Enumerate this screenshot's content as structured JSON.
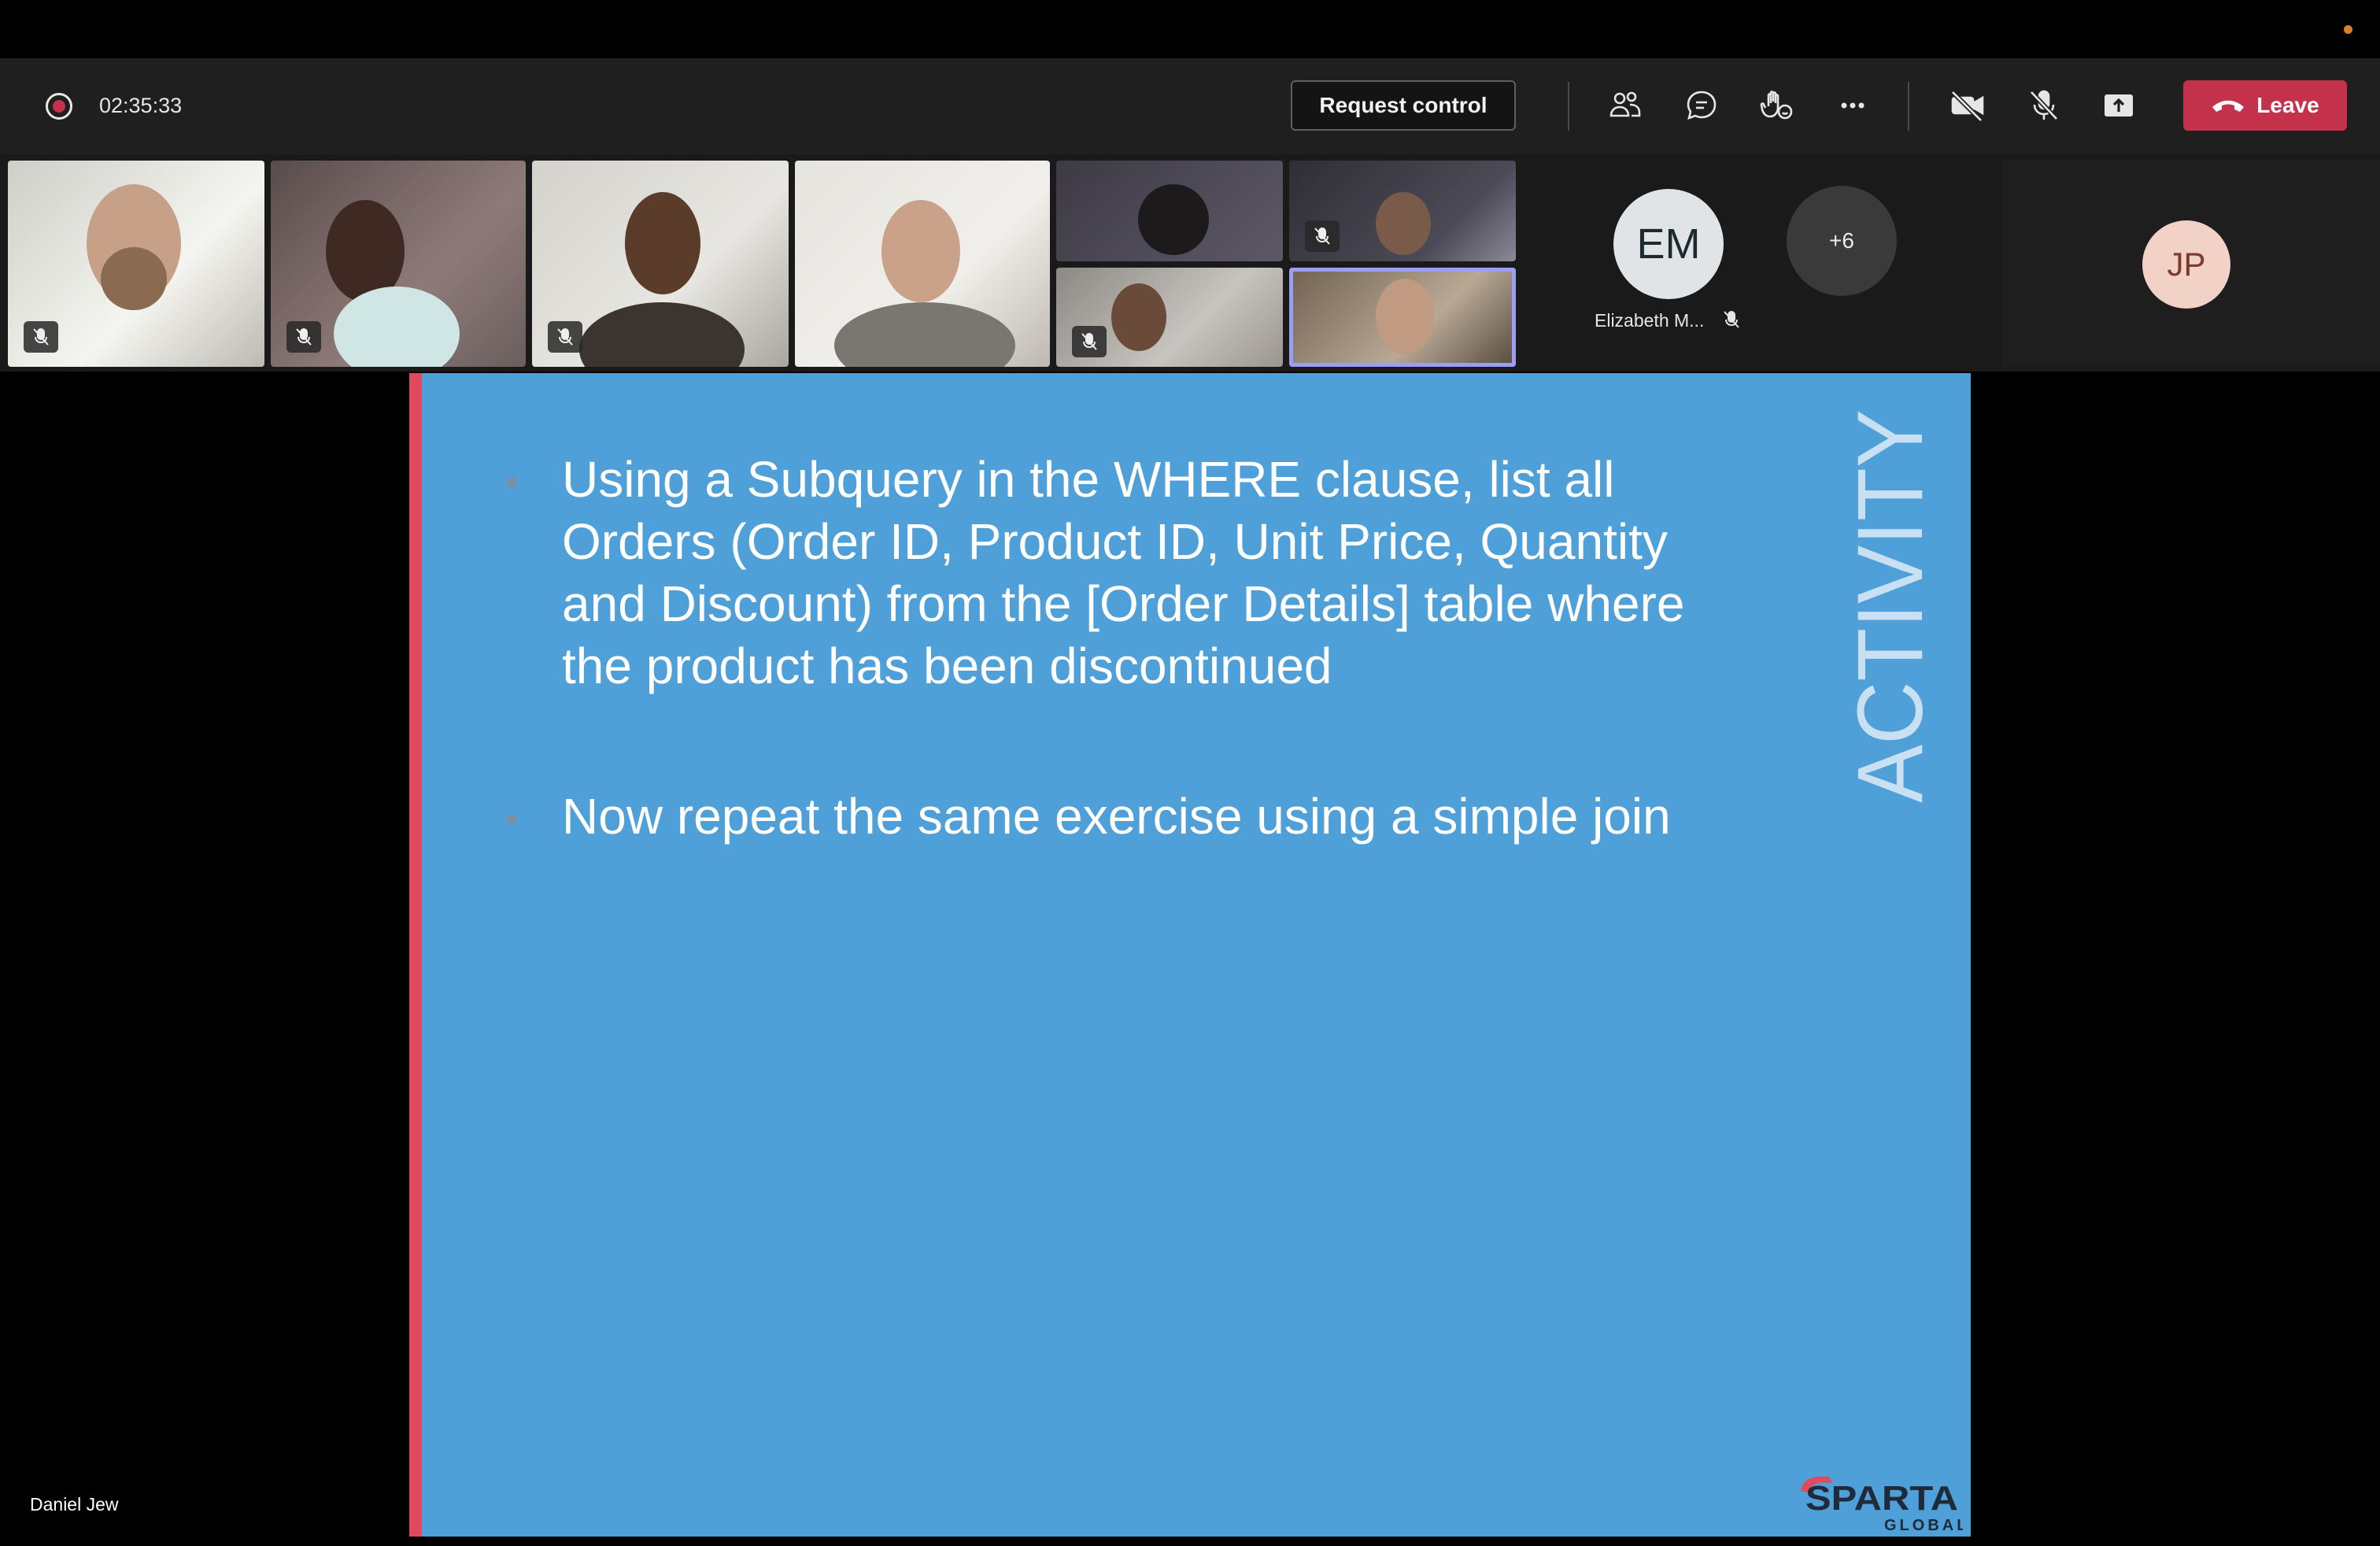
{
  "toolbar": {
    "timer": "02:35:33",
    "request_control_label": "Request control",
    "leave_label": "Leave",
    "icons": [
      "record-icon",
      "people-icon",
      "chat-icon",
      "raise-hand-icon",
      "more-options-icon",
      "camera-off-icon",
      "mic-off-icon",
      "share-screen-icon",
      "hang-up-icon"
    ],
    "leave_color": "#c4314b"
  },
  "participants": {
    "em_initials": "EM",
    "em_name": "Elizabeth M...",
    "more_count": "+6",
    "jp_initials": "JP",
    "selected_outline_color": "#9a9ef5"
  },
  "slide": {
    "bullets": [
      {
        "lines": [
          "Using a Subquery in the WHERE clause, list all",
          "Orders (Order ID, Product ID, Unit Price, Quantity",
          "and Discount) from the [Order Details] table where",
          "the product has been discontinued"
        ]
      },
      {
        "lines": [
          "Now repeat the same exercise using a simple join"
        ]
      }
    ],
    "side_title": "ACTIVITY",
    "logo_text": "SPARTA",
    "logo_subtext": "GLOBAL",
    "background_color": "#4f9fd8",
    "accent_color": "#e04a5c"
  },
  "presenter_name": "Daniel Jew"
}
